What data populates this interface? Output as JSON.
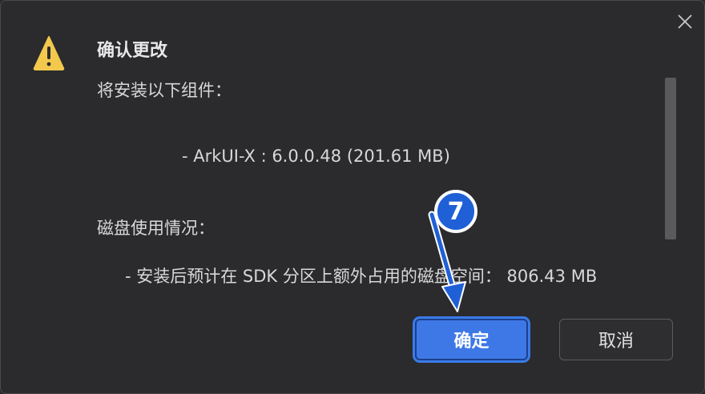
{
  "dialog": {
    "title": "确认更改",
    "intro": "将安装以下组件：",
    "components": [
      "- ArkUI-X : 6.0.0.48 (201.61 MB)"
    ],
    "disk_heading": "磁盘使用情况：",
    "disk_usage": "- 安装后预计在 SDK 分区上额外占用的磁盘空间：   806.43 MB",
    "ok_label": "确定",
    "cancel_label": "取消"
  },
  "annotation": {
    "step_number": "7"
  },
  "colors": {
    "background": "#2b2b2d",
    "accent": "#3e78e6",
    "warning": "#f2c94c",
    "annotation": "#1f60d6"
  },
  "icons": {
    "close": "close-icon",
    "warning": "warning-icon",
    "arrow": "arrow-icon"
  }
}
